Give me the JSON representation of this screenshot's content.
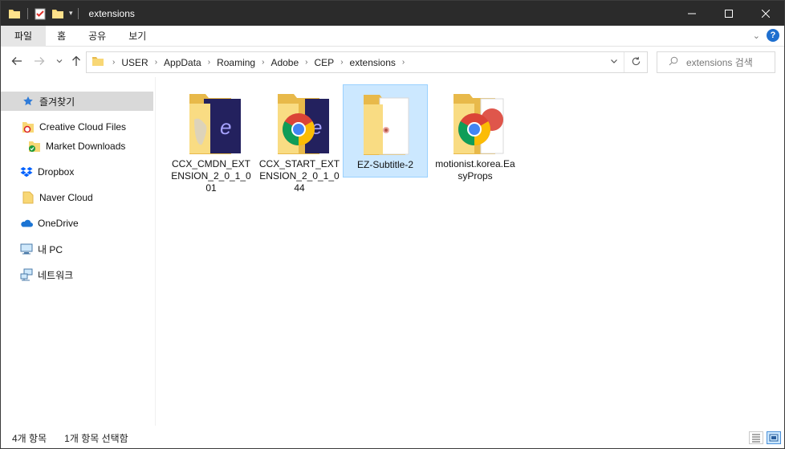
{
  "window": {
    "title": "extensions",
    "controls": {
      "minimize": "—",
      "maximize": "☐",
      "close": "✕"
    }
  },
  "ribbon": {
    "tabs": [
      "파일",
      "홈",
      "공유",
      "보기"
    ]
  },
  "address": {
    "crumbs": [
      "USER",
      "AppData",
      "Roaming",
      "Adobe",
      "CEP",
      "extensions"
    ]
  },
  "search": {
    "placeholder": "extensions 검색"
  },
  "sidebar": {
    "items": [
      {
        "label": "즐겨찾기",
        "icon": "star-icon"
      },
      {
        "label": "Creative Cloud Files",
        "icon": "creative-cloud-folder-icon"
      },
      {
        "label": "Market Downloads",
        "icon": "market-downloads-folder-icon"
      },
      {
        "label": "Dropbox",
        "icon": "dropbox-icon"
      },
      {
        "label": "Naver Cloud",
        "icon": "folder-icon"
      },
      {
        "label": "OneDrive",
        "icon": "onedrive-icon"
      },
      {
        "label": "내 PC",
        "icon": "pc-icon"
      },
      {
        "label": "네트워크",
        "icon": "network-icon"
      }
    ]
  },
  "files": [
    {
      "name": "CCX_CMDN_EXTENSION_2_0_1_001",
      "icon": "folder-with-adobe-doc-icon"
    },
    {
      "name": "CCX_START_EXTENSION_2_0_1_044",
      "icon": "folder-with-chrome-icon"
    },
    {
      "name": "EZ-Subtitle-2",
      "icon": "folder-with-page-icon"
    },
    {
      "name": "motionist.korea.EasyProps",
      "icon": "folder-with-chrome-icon"
    }
  ],
  "status": {
    "item_count": "4개 항목",
    "selected": "1개 항목 선택함"
  },
  "colors": {
    "titlebar": "#2b2b2b",
    "selection": "#cce8ff",
    "folder": "#f8d775",
    "help": "#1e6fcf"
  }
}
